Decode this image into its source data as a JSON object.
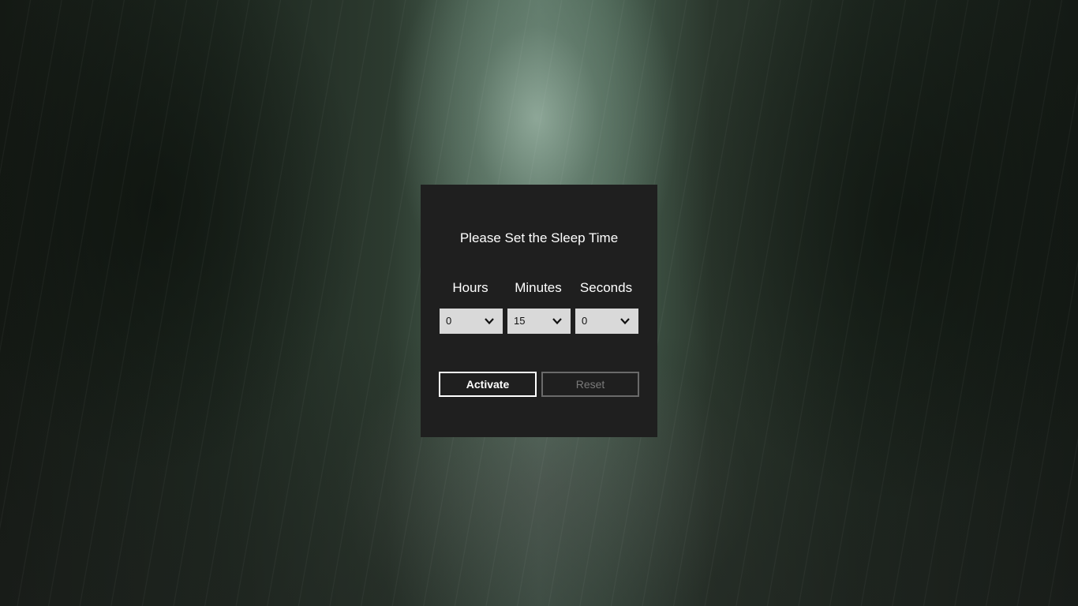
{
  "dialog": {
    "title": "Please Set the Sleep Time",
    "columns": [
      {
        "label": "Hours",
        "selected": "0"
      },
      {
        "label": "Minutes",
        "selected": "15"
      },
      {
        "label": "Seconds",
        "selected": "0"
      }
    ],
    "buttons": {
      "activate": "Activate",
      "reset": "Reset"
    }
  },
  "icons": {
    "dropdown": "chevron-down-icon"
  },
  "colors": {
    "dialog_bg": "#1f1f1f",
    "select_bg": "#d9d9d9",
    "text": "#ffffff",
    "disabled": "#7a7a7a"
  }
}
